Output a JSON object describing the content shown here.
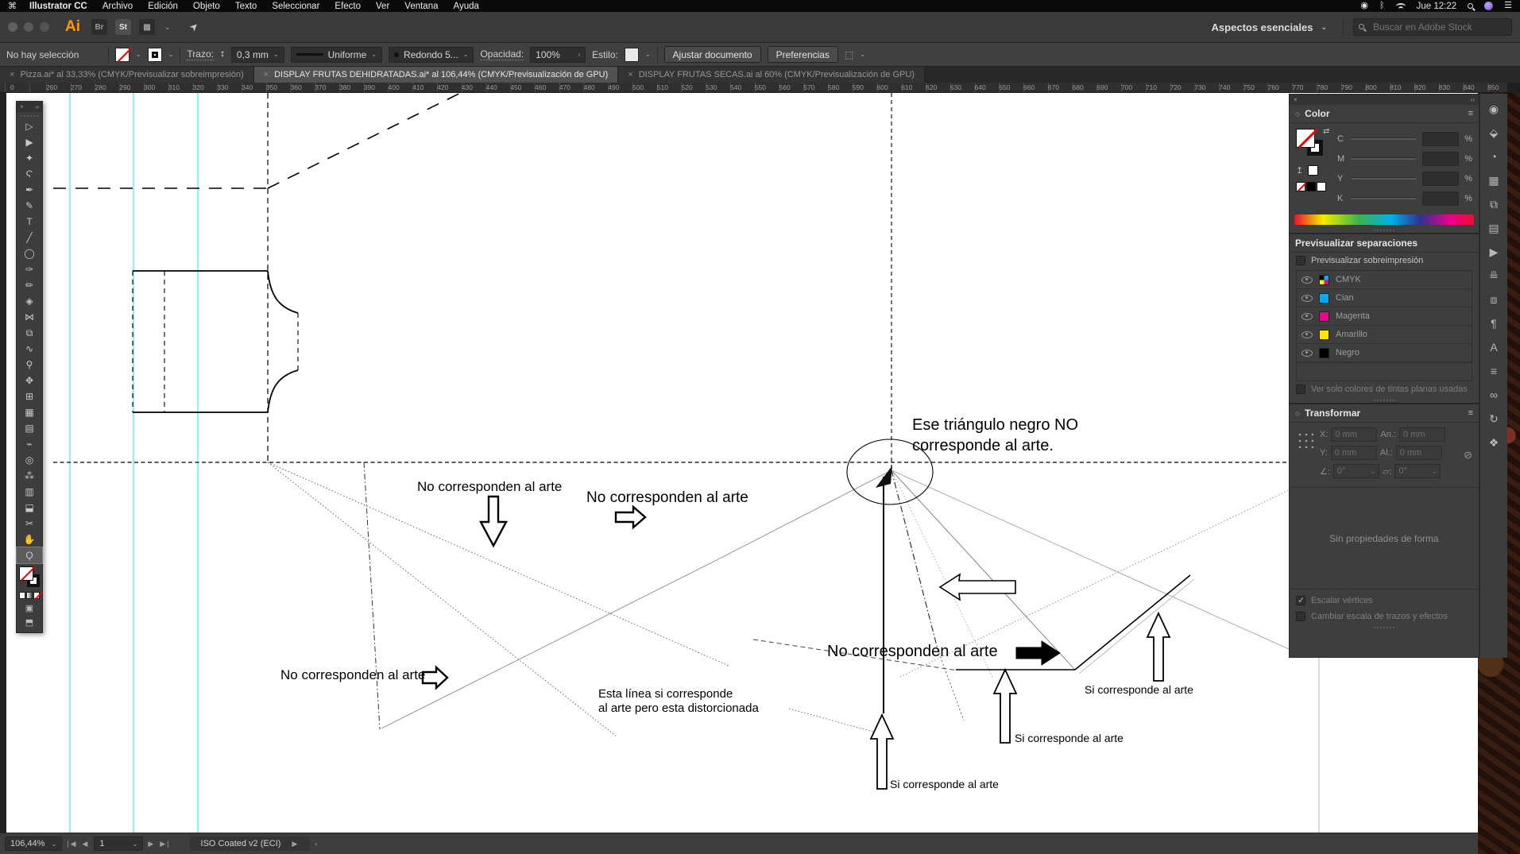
{
  "icons": {
    "close": "×",
    "collapse": "‹‹",
    "chevron": "⌄",
    "menu": "≡",
    "swap": "⇄",
    "apple": "⌘",
    "expand": "›",
    "flyout": "»",
    "up_arrow": "↥",
    "link_broken": "⊘",
    "angle": "∠:",
    "shear": "▱:",
    "prev": "◀",
    "next": "▶",
    "first": "|◀",
    "last": "▶|",
    "back_small": "‹"
  },
  "colors": {
    "accent_orange": "#ff9a00",
    "guide_cyan": "#2de1ec",
    "panel_bg": "#3e3e3e",
    "chip_cyan": "#00aeef",
    "chip_magenta": "#ec008c",
    "chip_yellow": "#ffe400",
    "chip_black": "#000000"
  },
  "menubar": {
    "items": [
      {
        "label": "Illustrator CC",
        "bold": true
      },
      {
        "label": "Archivo"
      },
      {
        "label": "Edición"
      },
      {
        "label": "Objeto"
      },
      {
        "label": "Texto"
      },
      {
        "label": "Seleccionar"
      },
      {
        "label": "Efecto"
      },
      {
        "label": "Ver"
      },
      {
        "label": "Ventana"
      },
      {
        "label": "Ayuda"
      }
    ],
    "time": "Jue 12:22"
  },
  "appbar": {
    "ai_logo": "Ai",
    "bridge_label": "Br",
    "stock_label": "St",
    "workspace": "Aspectos esenciales",
    "search_placeholder": "Buscar en Adobe Stock"
  },
  "controlbar": {
    "selection_status": "No hay selección",
    "stroke_label": "Trazo:",
    "stroke_value": "0,3 mm",
    "profile_value": "Uniforme",
    "brush_value": "Redondo 5...",
    "opacity_label": "Opacidad:",
    "opacity_value": "100%",
    "style_label": "Estilo:",
    "fit_button": "Ajustar documento",
    "prefs_button": "Preferencias"
  },
  "tabs": [
    {
      "title": "Pizza.ai* al 33,33% (CMYK/Previsualizar sobreimpresión)"
    },
    {
      "title": "DISPLAY FRUTAS DEHIDRATADAS.ai* al 106,44% (CMYK/Previsualización de GPU)",
      "active": true
    },
    {
      "title": "DISPLAY FRUTAS SECAS.ai al 60% (CMYK/Previsualización de GPU)"
    }
  ],
  "ruler": {
    "labels": [
      "0",
      "260",
      "270",
      "280",
      "290",
      "300",
      "310",
      "320",
      "330",
      "340",
      "350",
      "360",
      "370",
      "380",
      "390",
      "400",
      "410",
      "420",
      "430",
      "440",
      "450",
      "460",
      "470",
      "480",
      "490",
      "500",
      "510",
      "520",
      "530",
      "540",
      "550",
      "560",
      "570",
      "580",
      "590",
      "600",
      "610",
      "620",
      "630",
      "640",
      "650",
      "660",
      "670",
      "680",
      "690",
      "700",
      "710",
      "720",
      "730",
      "740",
      "750",
      "760",
      "770",
      "780",
      "790",
      "800",
      "810",
      "820",
      "830",
      "840",
      "850"
    ]
  },
  "toolbar": {
    "tools": [
      {
        "name": "selection",
        "glyph": "▷"
      },
      {
        "name": "direct-selection",
        "glyph": "▶"
      },
      {
        "name": "magic-wand",
        "glyph": "✦"
      },
      {
        "name": "lasso",
        "glyph": "Ϛ"
      },
      {
        "name": "pen",
        "glyph": "✒"
      },
      {
        "name": "curvature",
        "glyph": "✎"
      },
      {
        "name": "type",
        "glyph": "T"
      },
      {
        "name": "line-segment",
        "glyph": "╱"
      },
      {
        "name": "ellipse",
        "glyph": "◯"
      },
      {
        "name": "paintbrush",
        "glyph": "✑"
      },
      {
        "name": "shaper",
        "glyph": "✏"
      },
      {
        "name": "eraser",
        "glyph": "◈"
      },
      {
        "name": "reflect",
        "glyph": "⋈"
      },
      {
        "name": "scale",
        "glyph": "⧉"
      },
      {
        "name": "width",
        "glyph": "∿"
      },
      {
        "name": "puppet-warp",
        "glyph": "⚲"
      },
      {
        "name": "shape-builder",
        "glyph": "✥"
      },
      {
        "name": "perspective-grid",
        "glyph": "⊞"
      },
      {
        "name": "mesh",
        "glyph": "▦"
      },
      {
        "name": "gradient",
        "glyph": "▤"
      },
      {
        "name": "eyedropper",
        "glyph": "⌁"
      },
      {
        "name": "blend",
        "glyph": "◎"
      },
      {
        "name": "symbol-sprayer",
        "glyph": "⁂"
      },
      {
        "name": "column-graph",
        "glyph": "▥"
      },
      {
        "name": "artboard",
        "glyph": "⬓"
      },
      {
        "name": "slice",
        "glyph": "✂"
      },
      {
        "name": "hand",
        "glyph": "✋"
      },
      {
        "name": "zoom",
        "glyph": "Ϙ",
        "active": true
      }
    ]
  },
  "dock_icons": [
    {
      "name": "creative-cloud",
      "glyph": "◉"
    },
    {
      "name": "libraries",
      "glyph": "⬙"
    },
    {
      "name": "color-theme",
      "glyph": "◔"
    },
    {
      "name": "swatches",
      "glyph": "▦"
    },
    {
      "name": "symbols",
      "glyph": "⧉"
    },
    {
      "name": "gradient",
      "glyph": "▤"
    },
    {
      "name": "actions",
      "glyph": "▶"
    },
    {
      "name": "align",
      "glyph": "≞"
    },
    {
      "name": "pathfinder",
      "glyph": "⧈"
    },
    {
      "name": "paragraph",
      "glyph": "¶"
    },
    {
      "name": "character",
      "glyph": "A"
    },
    {
      "name": "opentype",
      "glyph": "≡"
    },
    {
      "name": "links",
      "glyph": "∞"
    },
    {
      "name": "shape-properties",
      "glyph": "↻"
    },
    {
      "name": "layers",
      "glyph": "❖"
    }
  ],
  "panels": {
    "color": {
      "title": "Color",
      "percent": "%",
      "channels": [
        {
          "label": "C"
        },
        {
          "label": "M"
        },
        {
          "label": "Y"
        },
        {
          "label": "K"
        }
      ]
    },
    "separations": {
      "title": "Previsualizar separaciones",
      "overprint_checkbox": "Previsualizar sobreimpresión",
      "channels": [
        {
          "label": "CMYK",
          "color": "cmyk"
        },
        {
          "label": "Cian",
          "color": "#00aeef"
        },
        {
          "label": "Magenta",
          "color": "#ec008c"
        },
        {
          "label": "Amarillo",
          "color": "#ffe400"
        },
        {
          "label": "Negro",
          "color": "#000000"
        }
      ],
      "spot_checkbox": "Ver solo colores de tintas planas usadas"
    },
    "transform": {
      "title": "Transformar",
      "x_label": "X:",
      "y_label": "Y:",
      "w_label": "An.:",
      "h_label": "Al.:",
      "x_value": "0 mm",
      "y_value": "0 mm",
      "w_value": "0 mm",
      "h_value": "0 mm",
      "angle_value": "0°",
      "shear_value": "0°",
      "empty_note": "Sin propiedades de forma",
      "check_scale_corners": "Escalar vértices",
      "check_scale_strokes": "Cambiar escala de trazos y efectos"
    }
  },
  "canvas": {
    "annotations": {
      "triangle_note_l1": "Ese triángulo negro NO",
      "triangle_note_l2": "corresponde al arte.",
      "not_art_1": "No corresponden al arte",
      "not_art_2": "No corresponden al arte",
      "not_art_3": "No corresponden al arte",
      "not_art_4": "No corresponden al arte",
      "distorted_l1": "Esta línea si corresponde",
      "distorted_l2": "al arte pero esta distorcionada",
      "is_art_1": "Si corresponde al arte",
      "is_art_2": "Si corresponde al arte",
      "is_art_3": "Si corresponde al arte"
    }
  },
  "statusbar": {
    "zoom_value": "106,44%",
    "page_value": "1",
    "profile": "ISO Coated v2 (ECI)"
  }
}
